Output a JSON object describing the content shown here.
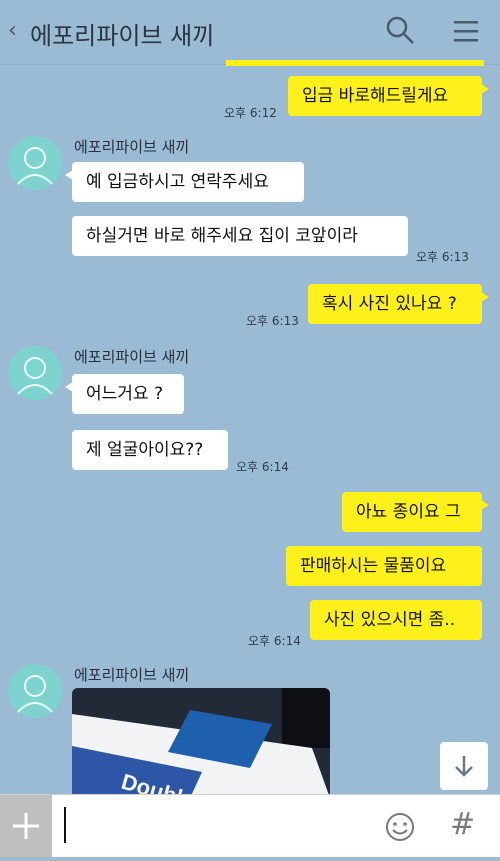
{
  "header": {
    "back_icon": "‹",
    "title": "에포리파이브 새끼"
  },
  "messages": {
    "m1": {
      "text": "입금 바로해드릴게요",
      "time": "오후 6:12"
    },
    "sender1": "에포리파이브 새끼",
    "m2": {
      "text": "예 입금하시고 연락주세요"
    },
    "m3": {
      "text": "하실거면 바로 해주세요 집이 코앞이라",
      "time": "오후 6:13"
    },
    "m4": {
      "text": "혹시 사진 있나요 ?",
      "time": "오후 6:13"
    },
    "sender2": "에포리파이브 새끼",
    "m5": {
      "text": "어느거요 ?"
    },
    "m6": {
      "text": "제 얼굴아이요??",
      "time": "오후 6:14"
    },
    "m7": {
      "text": "아뇨 종이요 그"
    },
    "m8": {
      "text": "판매하시는 물품이요"
    },
    "m9": {
      "text": "사진 있으시면 좀..",
      "time": "오후 6:14"
    },
    "sender3": "에포리파이브 새끼",
    "image_text": "Double"
  },
  "input": {
    "plus_label": "+",
    "hash_label": "#"
  },
  "colors": {
    "background": "#9bbbd4",
    "my_bubble": "#fef01b",
    "their_bubble": "#ffffff",
    "avatar": "#7fd3cf"
  },
  "icons": [
    "back-icon",
    "search-icon",
    "menu-icon",
    "person-icon",
    "scroll-down-icon",
    "plus-icon",
    "emoji-icon",
    "hash-icon"
  ]
}
